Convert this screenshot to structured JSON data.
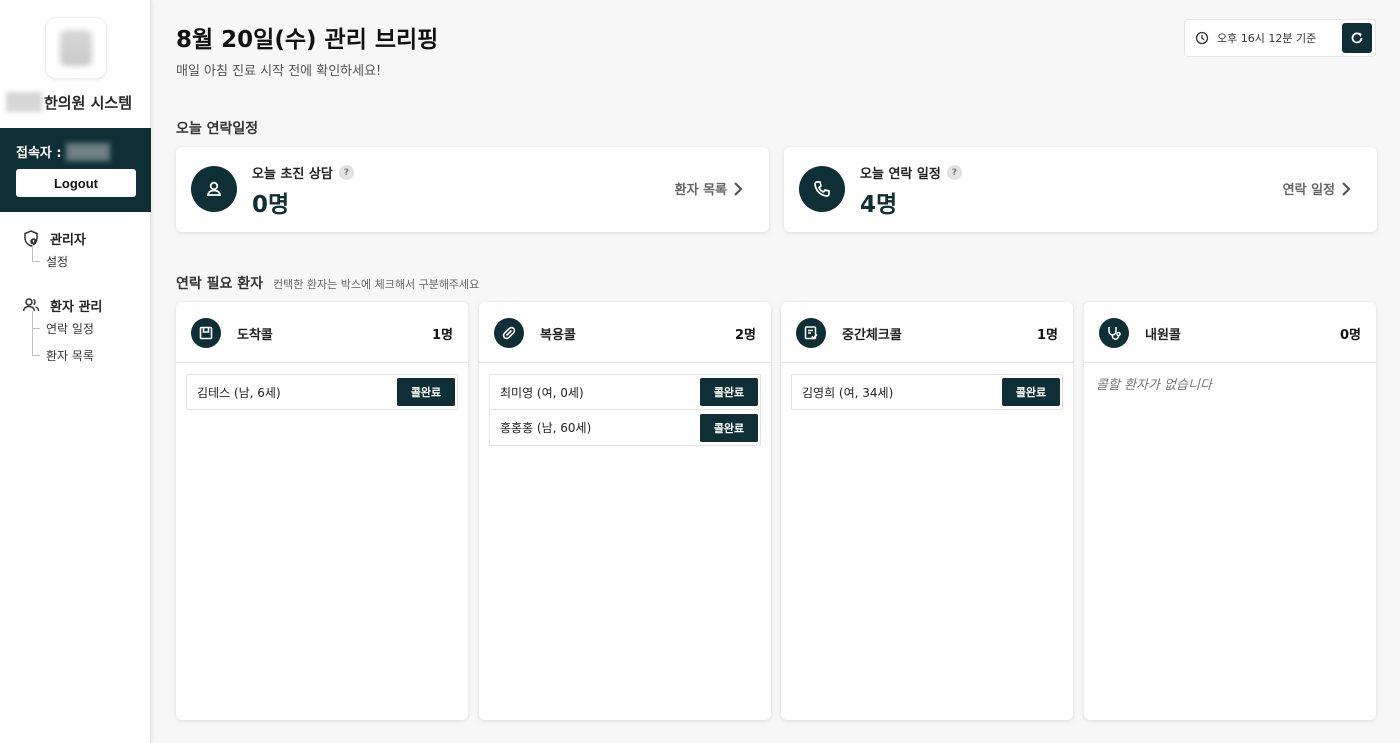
{
  "sidebar": {
    "system_name": "한의원 시스템",
    "user_label": "접속자 :",
    "logout_label": "Logout",
    "nav": [
      {
        "label": "관리자",
        "icon": "shield-icon",
        "items": [
          "설정"
        ]
      },
      {
        "label": "환자 관리",
        "icon": "users-icon",
        "items": [
          "연락 일정",
          "환자 목록"
        ]
      }
    ]
  },
  "header": {
    "title": "8월 20일(수) 관리 브리핑",
    "subtitle": "매일 아침 진료 시작 전에 확인하세요!",
    "time_label": "오후 16시 12분 기준"
  },
  "today": {
    "section_title": "오늘 연락일정",
    "cards": [
      {
        "label": "오늘 초진 상담",
        "value": "0명",
        "link": "환자 목록",
        "icon": "person-icon"
      },
      {
        "label": "오늘 연락 일정",
        "value": "4명",
        "link": "연락 일정",
        "icon": "phone-icon"
      }
    ]
  },
  "contact": {
    "section_title": "연락 필요 환자",
    "hint": "컨택한 환자는 박스에 체크해서 구분해주세요",
    "button_label": "콜완료",
    "empty_message": "콜할 환자가 없습니다",
    "columns": [
      {
        "title": "도착콜",
        "count": "1명",
        "icon": "box-icon",
        "patients": [
          "김테스 (남, 6세)"
        ]
      },
      {
        "title": "복용콜",
        "count": "2명",
        "icon": "pill-icon",
        "patients": [
          "최미영 (여, 0세)",
          "홍홍홍 (남, 60세)"
        ]
      },
      {
        "title": "중간체크콜",
        "count": "1명",
        "icon": "checklist-icon",
        "patients": [
          "김영희 (여, 34세)"
        ]
      },
      {
        "title": "내원콜",
        "count": "0명",
        "icon": "stethoscope-icon",
        "patients": []
      }
    ]
  },
  "colors": {
    "primary": "#0d2f35",
    "background": "#f7f7f7"
  }
}
